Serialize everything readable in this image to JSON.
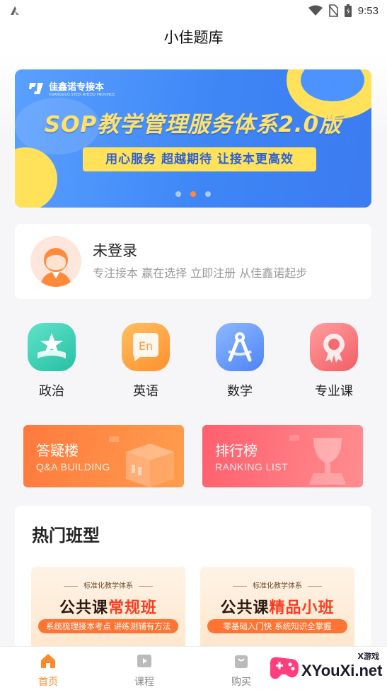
{
  "status_bar": {
    "time": "9:53"
  },
  "header": {
    "title": "小佳题库"
  },
  "banner": {
    "brand": "佳鑫诺专接本",
    "brand_sub": "HUANGGUO STEDI RHEDO PROVINCE",
    "headline": "SOP教学管理服务体系2.0版",
    "slogan": "用心服务  超越期待  让接本更高效",
    "dots": 3,
    "active_dot": 2
  },
  "login": {
    "title": "未登录",
    "subtitle": "专注接本 赢在选择 立即注册 从佳鑫诺起步"
  },
  "subjects": [
    {
      "label": "政治",
      "icon": "star-icon"
    },
    {
      "label": "英语",
      "icon": "en-bubble-icon"
    },
    {
      "label": "数学",
      "icon": "compass-icon"
    },
    {
      "label": "专业课",
      "icon": "medal-icon"
    }
  ],
  "promos": {
    "qa": {
      "title": "答疑楼",
      "subtitle": "Q&A BUILDING"
    },
    "rank": {
      "title": "排行榜",
      "subtitle": "RANKING LIST"
    }
  },
  "hot": {
    "title": "热门班型",
    "classes": [
      {
        "tag": "标准化教学体系",
        "name_a": "公共课",
        "name_b": "常规班",
        "slogan": "系统梳理接本考点 讲练测辅有方法"
      },
      {
        "tag": "标准化教学体系",
        "name_a": "公共课",
        "name_b": "精品小班",
        "slogan": "零基础入门快  系统知识全掌握"
      }
    ]
  },
  "nav": {
    "home": "首页",
    "courses": "课程",
    "buy": "购买"
  },
  "watermark": {
    "text": "XYouXi.net",
    "small": "X游戏"
  },
  "colors": {
    "accent": "#ff8a2b",
    "banner_blue": "#3e86f6",
    "banner_yellow": "#ffe15a"
  }
}
